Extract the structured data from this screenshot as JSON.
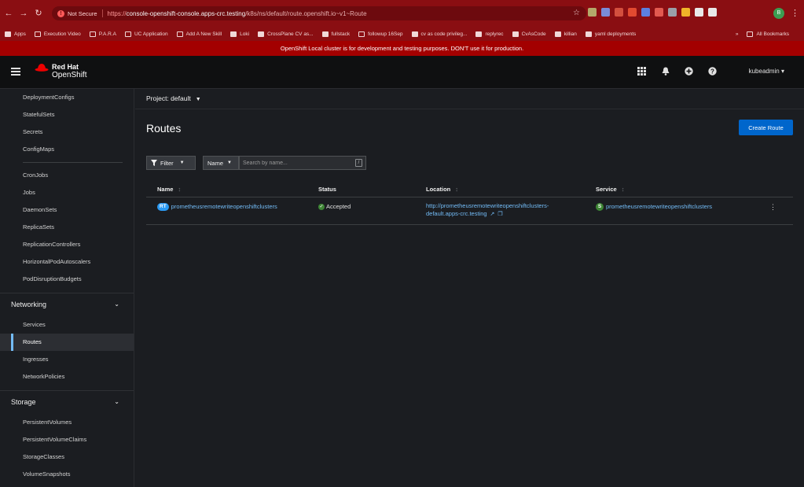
{
  "browser": {
    "back": "←",
    "forward": "→",
    "reload": "↻",
    "security_badge": "!",
    "security_label": "Not Secure",
    "url_scheme": "https://",
    "url_host": "console-openshift-console.apps-crc.testing",
    "url_path": "/k8s/ns/default/route.openshift.io~v1~Route",
    "star": "☆",
    "profile_initial": "B",
    "menu": "⋮",
    "ext_colors": [
      "#b4a96a",
      "#7a8cd8",
      "#d34f3e",
      "#e24a30",
      "#5c7fe0",
      "#e25a50",
      "#9aa0a8",
      "#f0b429",
      "#e8e8e8",
      "#e8e8e8"
    ]
  },
  "bookmarks": {
    "items": [
      "Apps",
      "Execution Video",
      "P.A.R.A",
      "UC Application",
      "Add A New Skill",
      "Loki",
      "CrossPlane CV as...",
      "fullstack",
      "followup 16Sep",
      "cv as code privileg...",
      "replyrec",
      "CvAsCode",
      "killian",
      "yaml deployments"
    ],
    "more": "»",
    "all": "All Bookmarks"
  },
  "banner": {
    "text": "OpenShift Local cluster is for development and testing purposes. DON'T use it for production."
  },
  "masthead": {
    "brand_line1": "Red Hat",
    "brand_line2": "OpenShift",
    "icons": [
      "⋮⋮⋮",
      "🔔",
      "⊕",
      "?"
    ],
    "user": "kubeadmin",
    "user_caret": "▾",
    "hat_color": "#ee0000"
  },
  "sidebar": {
    "workloads": [
      "DeploymentConfigs",
      "StatefulSets",
      "Secrets",
      "ConfigMaps"
    ],
    "workloads2": [
      "CronJobs",
      "Jobs",
      "DaemonSets",
      "ReplicaSets",
      "ReplicationControllers",
      "HorizontalPodAutoscalers",
      "PodDisruptionBudgets"
    ],
    "networking": {
      "title": "Networking",
      "chevron": "⌄",
      "items": [
        "Services",
        "Routes",
        "Ingresses",
        "NetworkPolicies"
      ],
      "active": "Routes"
    },
    "storage": {
      "title": "Storage",
      "chevron": "⌄",
      "items": [
        "PersistentVolumes",
        "PersistentVolumeClaims",
        "StorageClasses",
        "VolumeSnapshots"
      ]
    }
  },
  "main": {
    "project_label": "Project: default",
    "project_caret": "▼",
    "title": "Routes",
    "create_button": "Create Route",
    "filter_label": "Filter",
    "filter_icon": "▼",
    "filter_caret": "▼",
    "name_select": "Name",
    "name_caret": "▼",
    "search_placeholder": "Search by name...",
    "search_shortcut": "/",
    "columns": {
      "name": "Name",
      "status": "Status",
      "location": "Location",
      "service": "Service",
      "sort": "↕"
    },
    "rows": [
      {
        "badge": "RT",
        "name": "prometheusremotewriteopenshiftclusters",
        "status_icon": "✓",
        "status": "Accepted",
        "location_line1": "http://prometheusremotewriteopenshiftclusters-",
        "location_line2": "default.apps-crc.testing",
        "external_icon": "↗",
        "copy_icon": "❐",
        "service_badge": "S",
        "service": "prometheusremotewriteopenshiftclusters",
        "kebab": "⋮"
      }
    ]
  }
}
